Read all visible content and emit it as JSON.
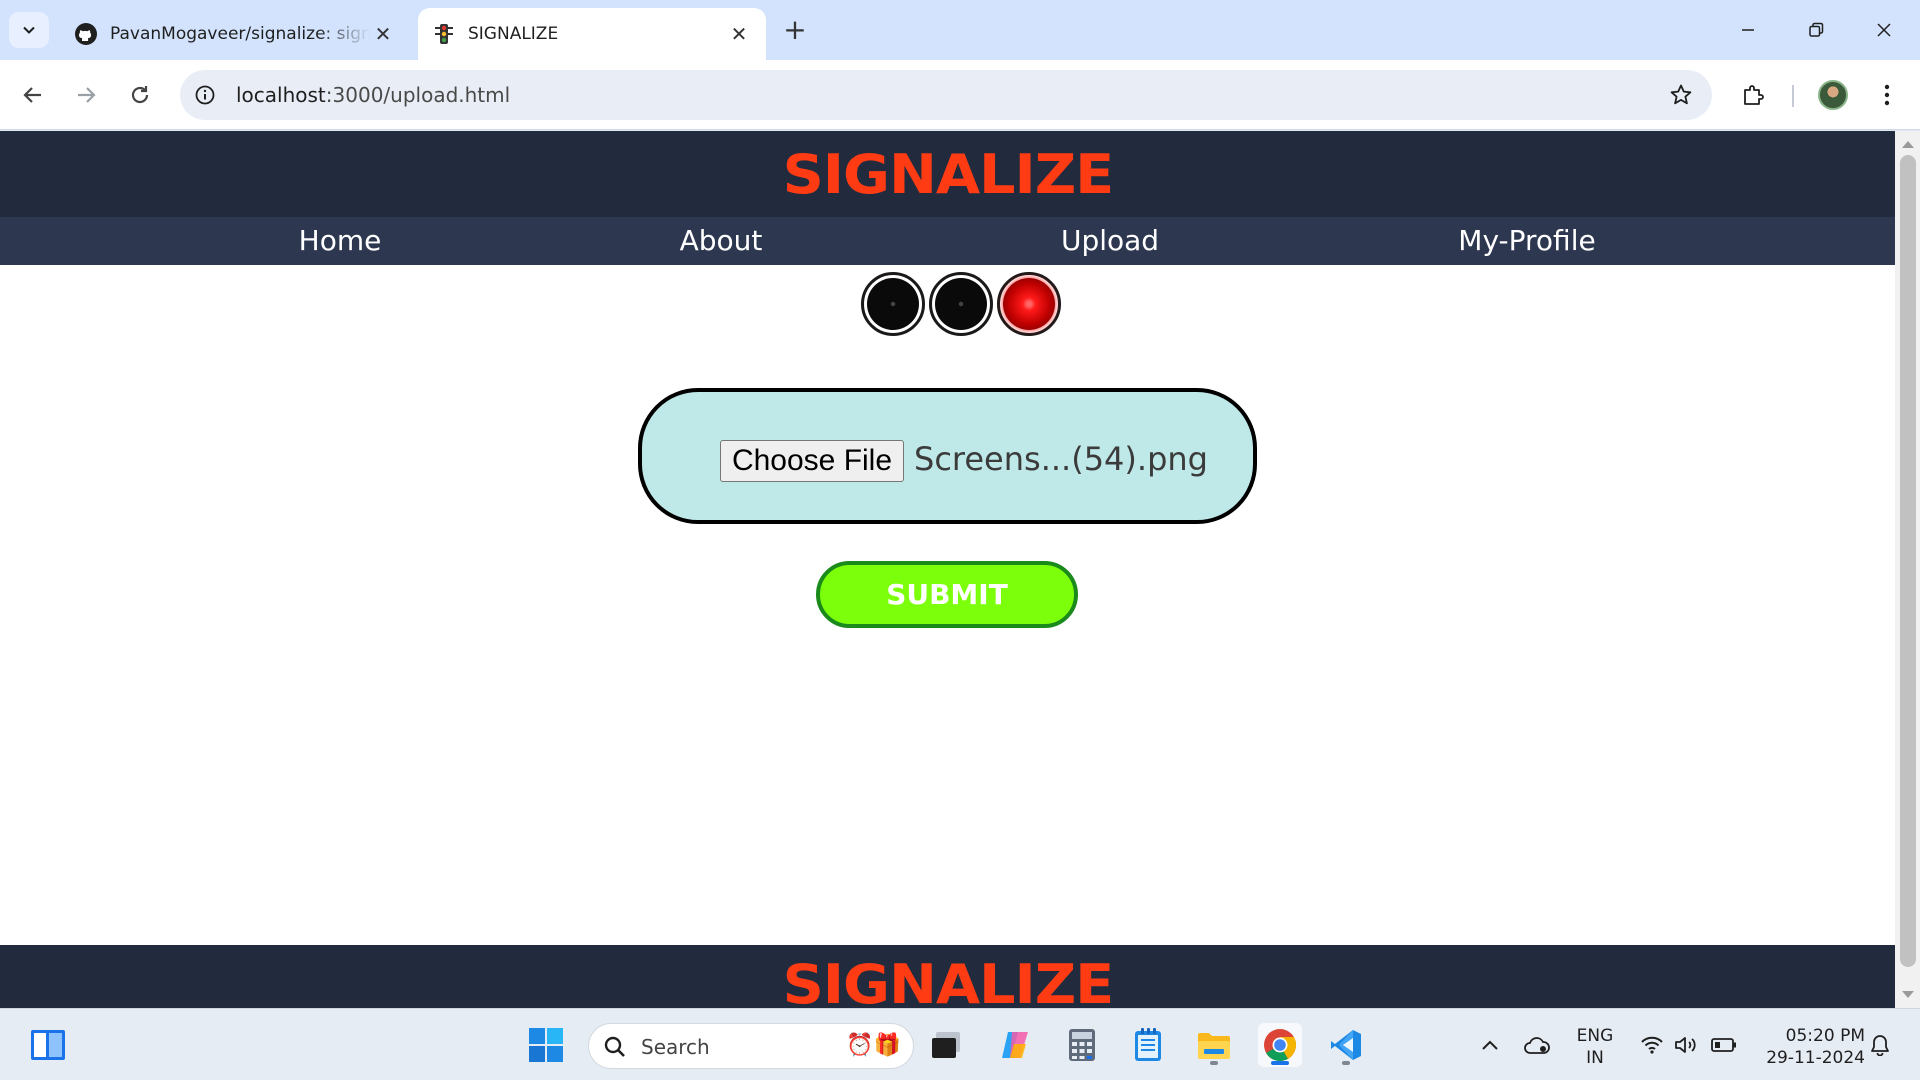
{
  "browser": {
    "tabs": [
      {
        "title": "PavanMogaveer/signalize: signa",
        "active": false
      },
      {
        "title": "SIGNALIZE",
        "active": true
      }
    ],
    "new_tab_label": "+",
    "url_host": "localhost",
    "url_path": ":3000/upload.html"
  },
  "site": {
    "brand": "SIGNALIZE",
    "nav": [
      {
        "label": "Home"
      },
      {
        "label": "About"
      },
      {
        "label": "Upload"
      },
      {
        "label": "My-Profile"
      }
    ],
    "signal_lights": [
      "off",
      "off",
      "red"
    ],
    "upload": {
      "button_label": "Choose File",
      "file_name": "Screens...(54).png"
    },
    "submit_label": "SUBMIT",
    "footer_brand": "SIGNALIZE"
  },
  "taskbar": {
    "search_placeholder": "Search",
    "language": "ENG",
    "region": "IN",
    "time": "05:20 PM",
    "date": "29-11-2024",
    "apps": [
      "start-icon",
      "task-view-icon",
      "copilot-icon",
      "calculator-icon",
      "notepad-icon",
      "file-explorer-icon",
      "chrome-icon",
      "vscode-icon"
    ]
  },
  "colors": {
    "header_bg": "#222b3d",
    "nav_bg": "#2d3850",
    "brand": "#ff3b14",
    "upload_bg": "#bfe8e8",
    "submit_bg": "#7cff0b",
    "submit_border": "#1a8a1a"
  }
}
